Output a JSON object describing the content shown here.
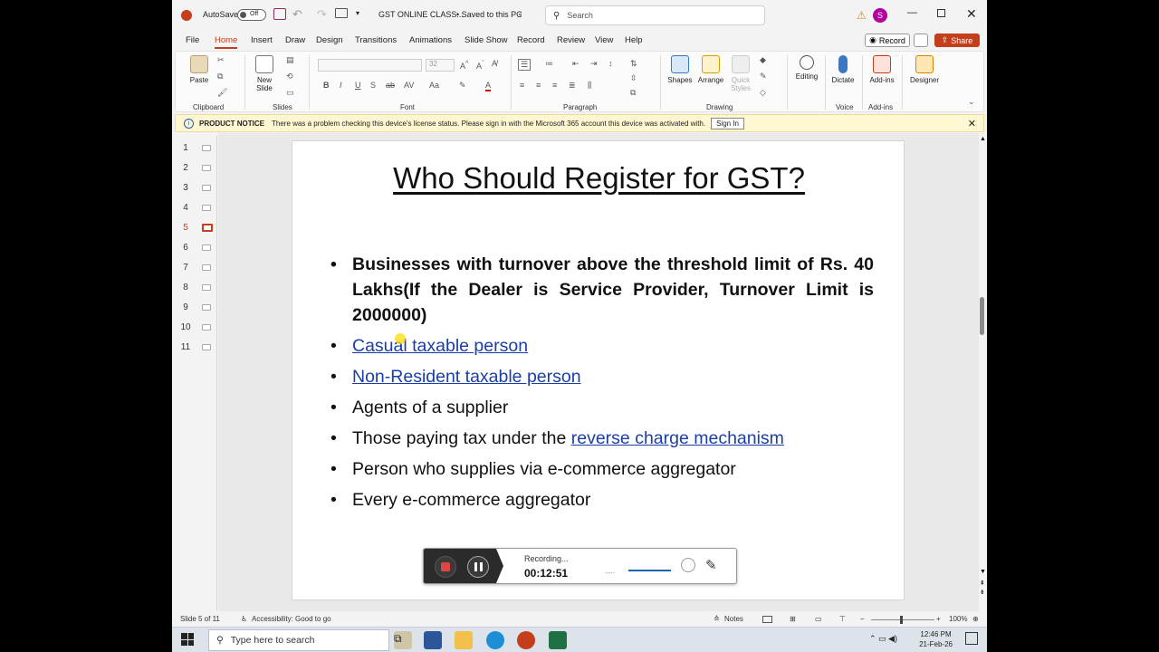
{
  "titlebar": {
    "autosave_label": "AutoSave",
    "autosave_state": "Off",
    "doc_title": "GST ONLINE CLASS...",
    "save_status": "• Saved to this PC",
    "search_placeholder": "Search",
    "avatar_initial": "S"
  },
  "menu": {
    "items": [
      "File",
      "Home",
      "Insert",
      "Draw",
      "Design",
      "Transitions",
      "Animations",
      "Slide Show",
      "Record",
      "Review",
      "View",
      "Help"
    ],
    "active": "Home",
    "record_label": "Record",
    "share_label": "Share"
  },
  "ribbon": {
    "paste": "Paste",
    "new_slide": "New Slide",
    "font_size": "32",
    "shapes": "Shapes",
    "arrange": "Arrange",
    "quick_styles": "Quick Styles",
    "editing": "Editing",
    "dictate": "Dictate",
    "addins": "Add-ins",
    "designer": "Designer",
    "groups": [
      "Clipboard",
      "Slides",
      "Font",
      "Paragraph",
      "Drawing",
      "Voice",
      "Add-ins"
    ]
  },
  "notice": {
    "title": "PRODUCT NOTICE",
    "message": "There was a problem checking this device's license status. Please sign in with the Microsoft 365 account this device was activated with.",
    "button": "Sign In"
  },
  "thumbnails": {
    "numbers": [
      "1",
      "2",
      "3",
      "4",
      "5",
      "6",
      "7",
      "8",
      "9",
      "10",
      "11"
    ],
    "active": "5"
  },
  "slide": {
    "title": "Who Should Register for GST?",
    "bullet_1": "Businesses with turnover above the threshold limit of Rs. 40 Lakhs(If the Dealer is Service Provider, Turnover Limit is 2000000)",
    "bullet_2": "Casual taxable person",
    "bullet_3": "Non-Resident taxable person",
    "bullet_4": "Agents of a supplier",
    "bullet_5_prefix": "Those paying tax under the ",
    "bullet_5_link": "reverse charge mechanism",
    "bullet_6": "Person who supplies via e-commerce aggregator",
    "bullet_7": "Every e-commerce aggregator"
  },
  "recorder": {
    "status": "Recording...",
    "time": "00:12:51",
    "dots": "....."
  },
  "statusbar": {
    "slide_info": "Slide 5 of 11",
    "accessibility": "Accessibility: Good to go",
    "notes": "Notes",
    "zoom": "100%"
  },
  "taskbar": {
    "search_placeholder": "Type here to search",
    "time": "12:46 PM",
    "date": "21-Feb-26"
  },
  "colors": {
    "accent": "#c43e1c",
    "link": "#1a3fa8",
    "notice_bg": "#fff7d1"
  }
}
